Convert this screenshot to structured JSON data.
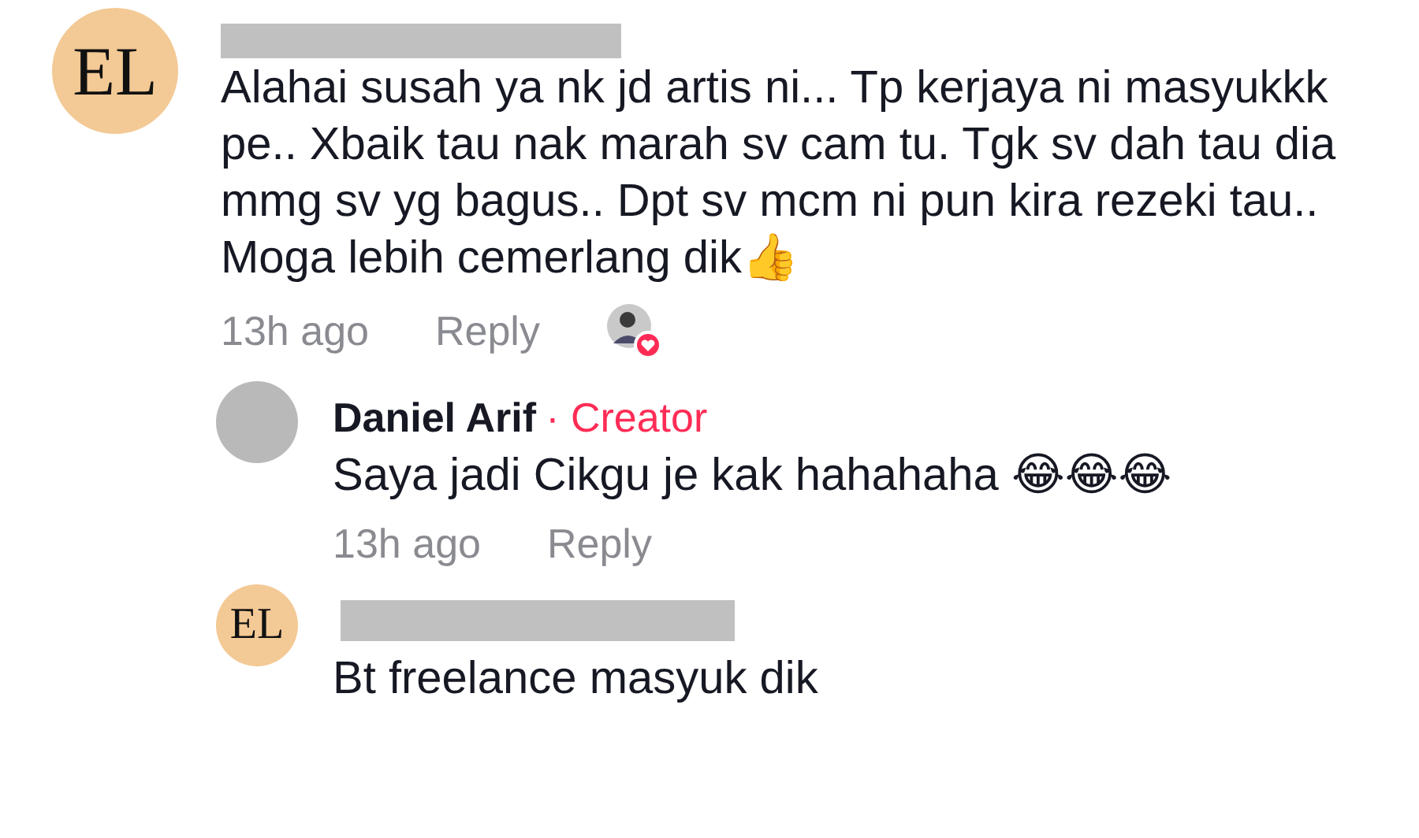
{
  "comments": [
    {
      "author": {
        "monogram": "EL",
        "redacted": true
      },
      "text": "Alahai susah ya nk jd artis ni... Tp kerjaya ni masyukkk pe.. Xbaik tau nak marah sv cam tu. Tgk sv dah tau dia mmg sv yg bagus.. Dpt sv mcm ni pun kira rezeki tau.. Moga lebih cemerlang dik👍",
      "time": "13h ago",
      "reply": "Reply",
      "liked_by_creator": true,
      "replies": [
        {
          "author": {
            "name": "Daniel Arif",
            "badge": "· Creator"
          },
          "text": "Saya jadi Cikgu je kak hahahaha 😂😂😂",
          "time": "13h ago",
          "reply": "Reply",
          "liked_by_creator": false
        },
        {
          "author": {
            "monogram": "EL",
            "redacted": true
          },
          "text": "Bt freelance masyuk dik"
        }
      ]
    }
  ]
}
